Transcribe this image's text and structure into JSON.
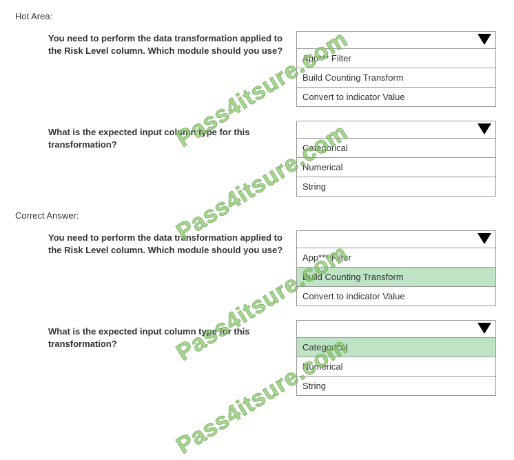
{
  "labels": {
    "hotArea": "Hot Area:",
    "correctAnswer": "Correct Answer:"
  },
  "questions": {
    "q1": "You need to perform the data transformation applied to the Risk Level column. Which module should you use?",
    "q2": "What is the expected input column type for this transformation?"
  },
  "options": {
    "moduleOptions": [
      "App*** Filter",
      "Build Counting Transform",
      "Convert to indicator Value"
    ],
    "typeOptions": [
      "Categorical",
      "Numerical",
      "String"
    ]
  },
  "watermark": "Pass4itsure.com"
}
